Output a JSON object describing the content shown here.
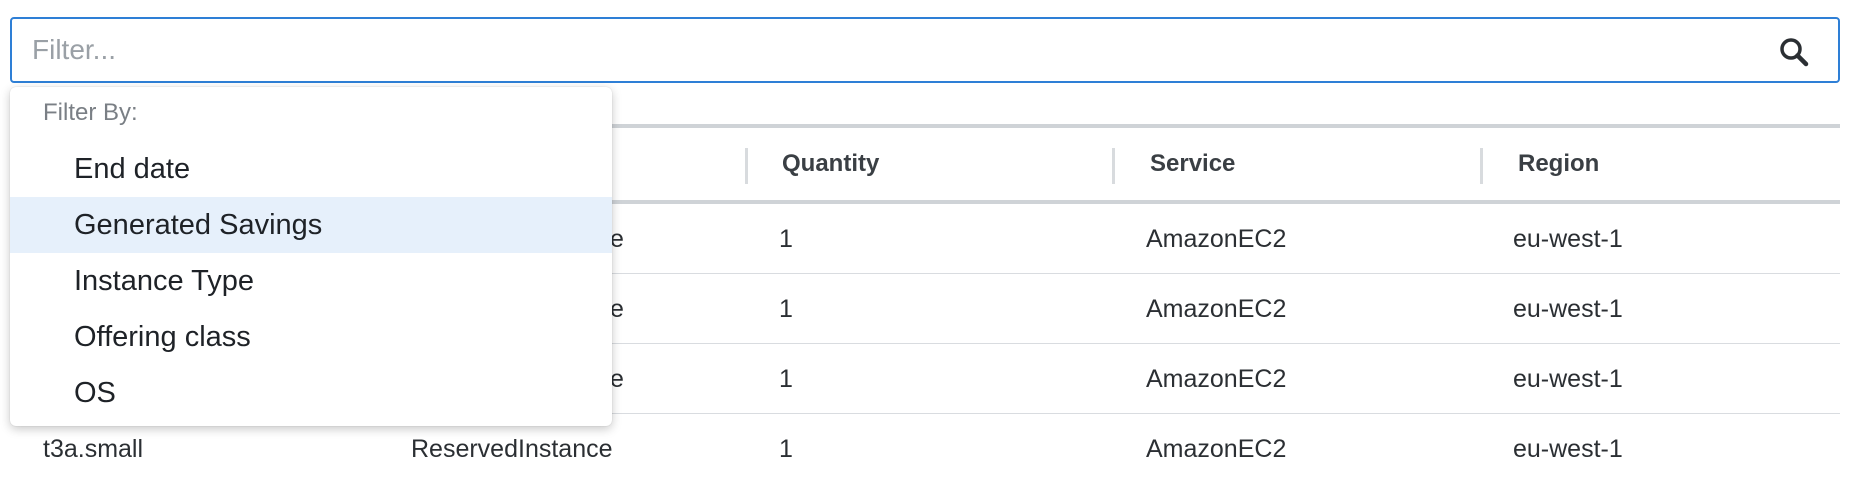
{
  "filter": {
    "placeholder": "Filter...",
    "value": "",
    "icon": "search-icon"
  },
  "dropdown": {
    "heading": "Filter By:",
    "items": [
      {
        "label": "End date",
        "active": false
      },
      {
        "label": "Generated Savings",
        "active": true
      },
      {
        "label": "Instance Type",
        "active": false
      },
      {
        "label": "Offering class",
        "active": false
      },
      {
        "label": "OS",
        "active": false
      }
    ]
  },
  "table": {
    "columns": [
      "Quantity",
      "Service",
      "Region"
    ],
    "rows": [
      {
        "col1": "",
        "col2": "e",
        "quantity": "1",
        "service": "AmazonEC2",
        "region": "eu-west-1"
      },
      {
        "col1": "",
        "col2": "e",
        "quantity": "1",
        "service": "AmazonEC2",
        "region": "eu-west-1"
      },
      {
        "col1": "",
        "col2": "e",
        "quantity": "1",
        "service": "AmazonEC2",
        "region": "eu-west-1"
      },
      {
        "col1": "t3a.small",
        "col2": "ReservedInstance",
        "quantity": "1",
        "service": "AmazonEC2",
        "region": "eu-west-1"
      }
    ]
  },
  "colors": {
    "accent": "#2e7fd6",
    "highlight": "#e6f0fb"
  }
}
